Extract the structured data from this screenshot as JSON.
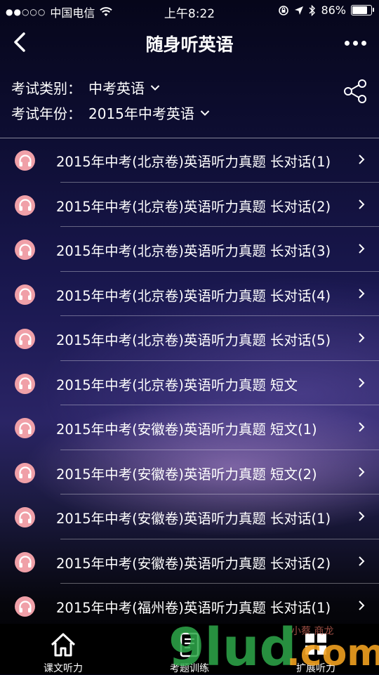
{
  "status_bar": {
    "signal": "●●○○○",
    "carrier": "中国电信",
    "time": "上午8:22",
    "battery": "86%",
    "battery_level": 0.86
  },
  "nav": {
    "title": "随身听英语"
  },
  "filters": {
    "category_label": "考试类别：",
    "category_value": "中考英语",
    "year_label": "考试年份：",
    "year_value": "2015年中考英语"
  },
  "items": [
    {
      "label": "2015年中考(北京卷)英语听力真题 长对话(1)"
    },
    {
      "label": "2015年中考(北京卷)英语听力真题 长对话(2)"
    },
    {
      "label": "2015年中考(北京卷)英语听力真题 长对话(3)"
    },
    {
      "label": "2015年中考(北京卷)英语听力真题 长对话(4)"
    },
    {
      "label": "2015年中考(北京卷)英语听力真题 长对话(5)"
    },
    {
      "label": "2015年中考(北京卷)英语听力真题 短文"
    },
    {
      "label": "2015年中考(安徽卷)英语听力真题 短文(1)"
    },
    {
      "label": "2015年中考(安徽卷)英语听力真题 短文(2)"
    },
    {
      "label": "2015年中考(安徽卷)英语听力真题 长对话(1)"
    },
    {
      "label": "2015年中考(安徽卷)英语听力真题 长对话(2)"
    },
    {
      "label": "2015年中考(福州卷)英语听力真题 长对话(1)"
    }
  ],
  "tabs": [
    {
      "label": "课文听力",
      "icon": "home-icon"
    },
    {
      "label": "考题训练",
      "icon": "exam-icon"
    },
    {
      "label": "扩展听力",
      "icon": "grid-icon"
    }
  ],
  "watermark": {
    "brand": "9lud.com",
    "tagline": "小蔡 商龙"
  },
  "colors": {
    "icon_pink": "#f0a0a8",
    "tab_bg": "#000000",
    "watermark_green": "#2ea84a",
    "watermark_orange": "#f0a020"
  }
}
